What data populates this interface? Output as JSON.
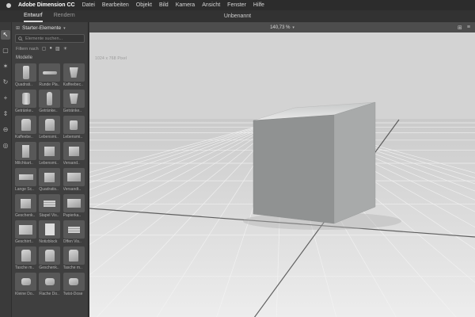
{
  "menubar": {
    "items": [
      "Adobe Dimension CC",
      "Datei",
      "Bearbeiten",
      "Objekt",
      "Bild",
      "Kamera",
      "Ansicht",
      "Fenster",
      "Hilfe"
    ]
  },
  "tabbar": {
    "tabs": [
      {
        "label": "Entwurf",
        "active": true
      },
      {
        "label": "Rendern",
        "active": false
      }
    ],
    "document_title": "Unbenannt"
  },
  "toolrail": {
    "tools": [
      {
        "name": "select-tool",
        "glyph": "↖"
      },
      {
        "name": "marquee-select-tool",
        "glyph": "▢"
      },
      {
        "name": "magic-wand-tool",
        "glyph": "✶"
      },
      {
        "name": "orbit-camera-tool",
        "glyph": "↻"
      },
      {
        "name": "pan-camera-tool",
        "glyph": "+"
      },
      {
        "name": "dolly-camera-tool",
        "glyph": "⇕"
      },
      {
        "name": "horizon-tool",
        "glyph": "⊖"
      },
      {
        "name": "zoom-tool",
        "glyph": "◎"
      }
    ]
  },
  "assets_panel": {
    "title": "Starter-Elemente",
    "chevron": "▾",
    "search_placeholder": "Elemente suchen...",
    "filter_label": "Filtern nach",
    "filters": [
      {
        "name": "filter-models-icon",
        "glyph": "▢"
      },
      {
        "name": "filter-materials-icon",
        "glyph": "●"
      },
      {
        "name": "filter-images-icon",
        "glyph": "▨"
      },
      {
        "name": "filter-lights-icon",
        "glyph": "☀"
      }
    ],
    "section_title": "Modelle",
    "items": [
      {
        "label": "Quadrati..",
        "shape": "tall"
      },
      {
        "label": "Runde Pla..",
        "shape": "flat"
      },
      {
        "label": "Kaffeebec..",
        "shape": "cup"
      },
      {
        "label": "Getränke..",
        "shape": "can"
      },
      {
        "label": "Getränke..",
        "shape": "bottle"
      },
      {
        "label": "Getränke..",
        "shape": "cup"
      },
      {
        "label": "Kaffeebe..",
        "shape": "bag"
      },
      {
        "label": "Lebensmi..",
        "shape": "bag"
      },
      {
        "label": "Lebensmi..",
        "shape": "jar"
      },
      {
        "label": "Milchkart..",
        "shape": "carton"
      },
      {
        "label": "Lebensmi..",
        "shape": "box"
      },
      {
        "label": "Versand..",
        "shape": "box"
      },
      {
        "label": "Lange Sc..",
        "shape": "longbox"
      },
      {
        "label": "Quadratis..",
        "shape": "box"
      },
      {
        "label": "Versandt..",
        "shape": "envelope"
      },
      {
        "label": "Geschenk..",
        "shape": "box"
      },
      {
        "label": "Stapel Vis..",
        "shape": "stack"
      },
      {
        "label": "Papierka..",
        "shape": "envelope"
      },
      {
        "label": "Geschirrt..",
        "shape": "cloth"
      },
      {
        "label": "Notizblock",
        "shape": "notebook"
      },
      {
        "label": "Offen Vis..",
        "shape": "stack"
      },
      {
        "label": "Tasche m..",
        "shape": "bag"
      },
      {
        "label": "Geschenk..",
        "shape": "bag"
      },
      {
        "label": "Tasche m..",
        "shape": "bag"
      },
      {
        "label": "Kleine Do..",
        "shape": "tin"
      },
      {
        "label": "Flache Do..",
        "shape": "tin"
      },
      {
        "label": "Twist-Dose",
        "shape": "tin"
      }
    ]
  },
  "canvas_toolbar": {
    "zoom_level": "140,73 %",
    "chevron": "▾",
    "icons": [
      {
        "name": "grid-view-icon",
        "glyph": "⊞"
      },
      {
        "name": "view-settings-icon",
        "glyph": "≡"
      }
    ]
  },
  "viewport": {
    "size_label": "1024 x 768 Pixel"
  },
  "colors": {
    "menubar_bg": "#2c2c2c",
    "panel_bg": "#3f3f3f",
    "canvas_bg": "#d3d3d3",
    "cube_front": "#909292",
    "cube_right": "#a8aaaa",
    "cube_top": "#dfe1e1"
  }
}
